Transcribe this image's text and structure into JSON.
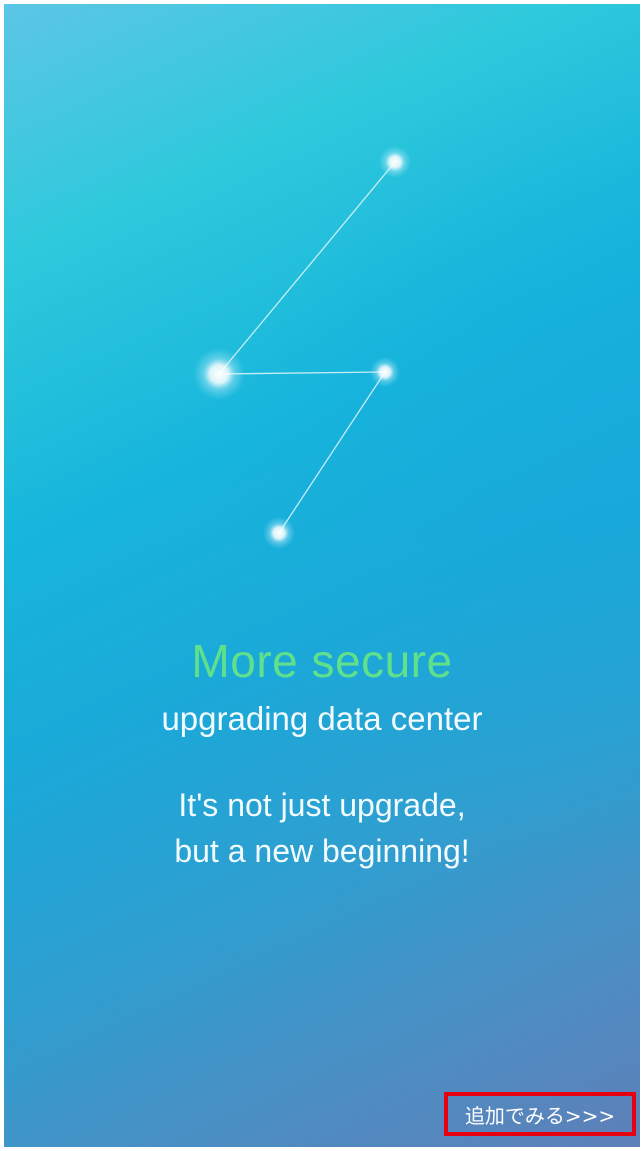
{
  "splash": {
    "headline": "More secure",
    "subheadline": "upgrading data center",
    "tagline_line1": "It's not just upgrade,",
    "tagline_line2": "but a new beginning!",
    "action_label": "追加でみる>>>"
  },
  "colors": {
    "headline": "#5fe08a",
    "text": "#f2fbff",
    "action_border": "#e50012",
    "background_top": "#2ec9dc",
    "background_bottom": "#5f7fb8"
  }
}
